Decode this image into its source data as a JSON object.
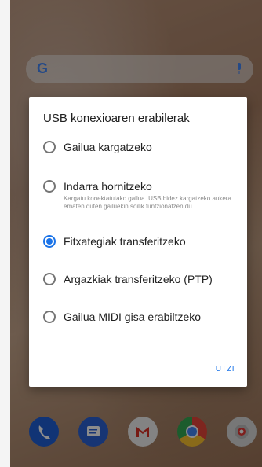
{
  "search": {
    "logo": "G",
    "mic": "mic-icon"
  },
  "dialog": {
    "title": "USB konexioaren erabilerak",
    "options": [
      {
        "label": "Gailua kargatzeko",
        "checked": false
      },
      {
        "label": "Indarra hornitzeko",
        "checked": false,
        "description": "Kargatu konektatutako gailua. USB bidez kargatzeko aukera ematen duten gailuekin soilik funtzionatzen du."
      },
      {
        "label": "Fitxategiak transferitzeko",
        "checked": true
      },
      {
        "label": "Argazkiak transferitzeko (PTP)",
        "checked": false
      },
      {
        "label": "Gailua MIDI gisa erabiltzeko",
        "checked": false
      }
    ],
    "cancel_label": "UTZI"
  },
  "dock": {
    "icons": [
      "phone-icon",
      "messages-icon",
      "gmail-icon",
      "chrome-icon",
      "camera-icon"
    ]
  },
  "colors": {
    "accent": "#1a73e8",
    "scrim": "#000000"
  }
}
